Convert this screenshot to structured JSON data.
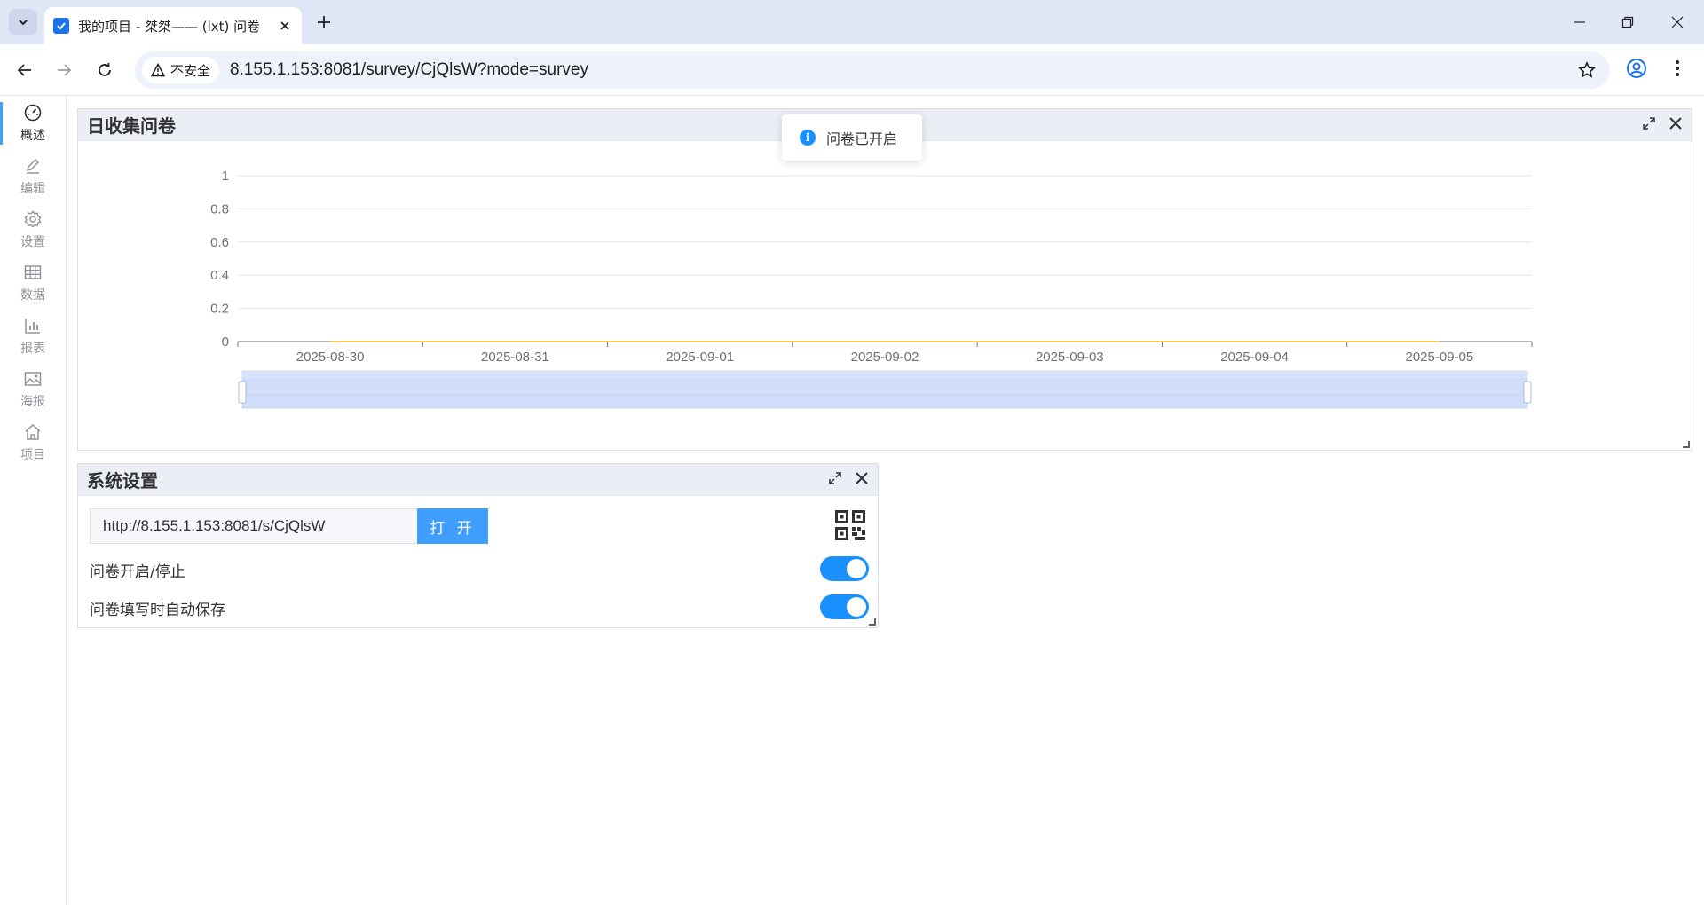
{
  "browser": {
    "tab_title": "我的项目 - 桀桀—— (lxt) 问卷",
    "security_label": "不安全",
    "url": "8.155.1.153:8081/survey/CjQlsW?mode=survey"
  },
  "rail": {
    "items": [
      {
        "label": "概述",
        "icon": "dashboard-icon",
        "active": true
      },
      {
        "label": "编辑",
        "icon": "edit-icon"
      },
      {
        "label": "设置",
        "icon": "gear-icon"
      },
      {
        "label": "数据",
        "icon": "table-icon"
      },
      {
        "label": "报表",
        "icon": "bar-chart-icon"
      },
      {
        "label": "海报",
        "icon": "image-icon"
      },
      {
        "label": "项目",
        "icon": "home-icon"
      }
    ]
  },
  "toast": {
    "message": "问卷已开启",
    "icon": "info-icon"
  },
  "chart_panel": {
    "title": "日收集问卷"
  },
  "chart_data": {
    "type": "line",
    "title": "",
    "x": [
      "2025-08-30",
      "2025-08-31",
      "2025-09-01",
      "2025-09-02",
      "2025-09-03",
      "2025-09-04",
      "2025-09-05"
    ],
    "series": [
      {
        "values": [
          0,
          0,
          0,
          0,
          0,
          0,
          0
        ],
        "color": "#fac858"
      }
    ],
    "y_ticks": [
      "0",
      "0.2",
      "0.4",
      "0.6",
      "0.8",
      "1"
    ],
    "ylim": [
      0,
      1
    ],
    "grid": true,
    "datazoom": {
      "start": 0,
      "end": 100
    }
  },
  "settings_panel": {
    "title": "系统设置",
    "survey_link": "http://8.155.1.153:8081/s/CjQlsW",
    "open_label": "打 开",
    "toggle_open_label": "问卷开启/停止",
    "toggle_open_value": true,
    "toggle_autosave_label": "问卷填写时自动保存",
    "toggle_autosave_value": true
  },
  "colors": {
    "accent": "#409eff",
    "switch_on": "#1890ff",
    "series": "#fac858"
  }
}
